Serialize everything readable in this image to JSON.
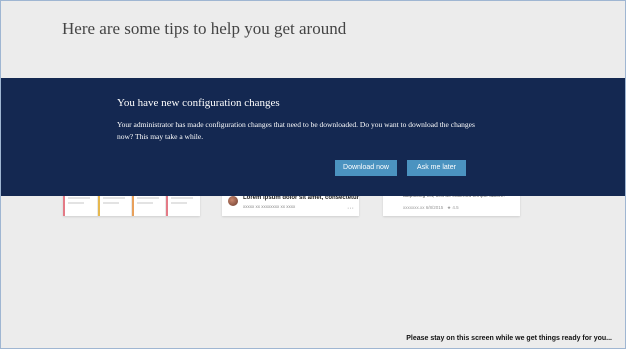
{
  "page": {
    "title": "Here are some tips to help you get around"
  },
  "dialog": {
    "title": "You have new configuration changes",
    "message": "Your administrator has made configuration changes that need to be downloaded. Do you want to download the changes now? This may take a while.",
    "download_button": "Download now",
    "later_button": "Ask me later"
  },
  "tips": {
    "card_b": {
      "title": "Lorem ipsum dolor sit amet, consectetur",
      "meta": "xxxxx xx xxxxxxxx xx xxxx",
      "more_icon": "more-icon"
    },
    "card_c": {
      "text": "adipiscing elit, sed do eiusmod tempor labore.",
      "meta": "xxxxxxx.xx 6/8/2015",
      "rating": "4.5",
      "star_icon": "star-icon"
    },
    "kanban_colors": [
      "#e47a86",
      "#e6b84f",
      "#e8a05b",
      "#e47a86"
    ]
  },
  "status": {
    "text": "Please stay on this screen while we get things ready for you..."
  },
  "colors": {
    "background": "#ececec",
    "banner": "#142851",
    "button": "#4b93c0"
  }
}
